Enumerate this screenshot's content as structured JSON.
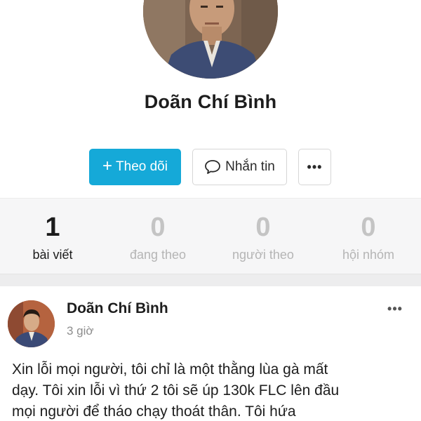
{
  "profile": {
    "name": "Doãn Chí Bình",
    "avatar_icon": "profile-photo-avatar",
    "follow_label": "Theo dõi",
    "follow_icon": "plus-icon",
    "message_label": "Nhắn tin",
    "message_icon": "chat-bubble-icon",
    "more_label": "•••",
    "accent_color": "#15a9d8"
  },
  "stats": [
    {
      "value": "1",
      "label": "bài viết"
    },
    {
      "value": "0",
      "label": "đang theo"
    },
    {
      "value": "0",
      "label": "người theo"
    },
    {
      "value": "0",
      "label": "hội nhóm"
    }
  ],
  "post": {
    "author": "Doãn Chí Bình",
    "time": "3 giờ",
    "more_label": "•••",
    "text_lines": [
      "Xin lỗi mọi người, tôi chỉ là một thằng lùa gà mất",
      "dạy. Tôi xin lỗi vì thứ 2 tôi sẽ úp 130k FLC lên đầu",
      "mọi người để tháo chạy thoát thân. Tôi hứa"
    ]
  }
}
